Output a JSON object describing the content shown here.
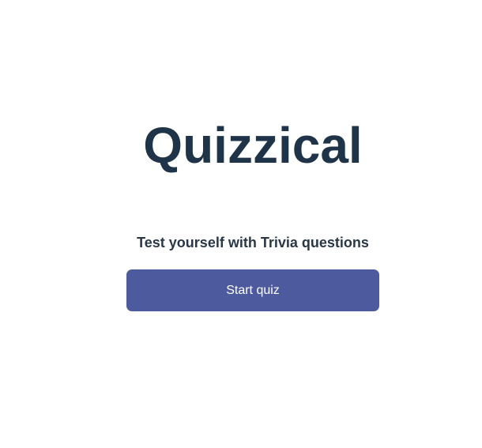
{
  "app": {
    "title": "Quizzical",
    "subtitle": "Test yourself with Trivia questions",
    "start_button_label": "Start quiz"
  },
  "colors": {
    "title": "#1f3448",
    "subtitle": "#293747",
    "button_background": "#4d5b9e",
    "button_text": "#ffffff",
    "page_background": "#ffffff"
  }
}
